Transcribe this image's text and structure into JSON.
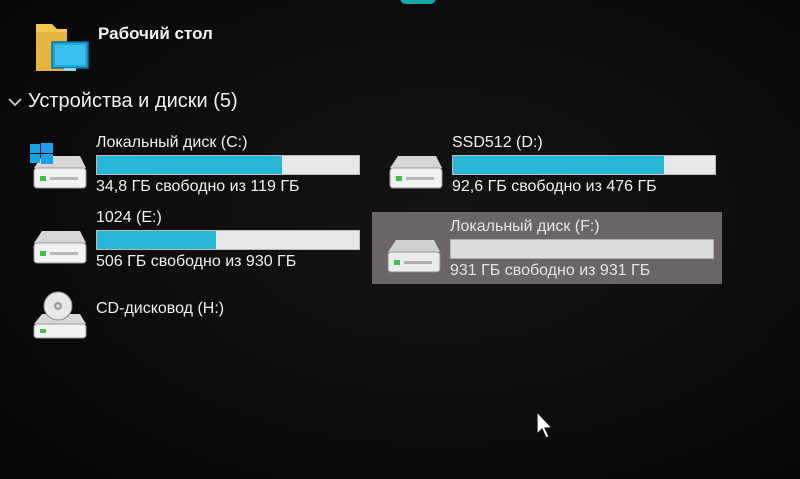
{
  "desktop": {
    "label": "Рабочий стол"
  },
  "group": {
    "title": "Устройства и диски (5)"
  },
  "drives": [
    {
      "name": "Локальный диск (C:)",
      "free_text": "34,8 ГБ свободно из 119 ГБ",
      "used_fraction": 0.708,
      "has_windows_logo": true,
      "selected": false
    },
    {
      "name": "SSD512 (D:)",
      "free_text": "92,6 ГБ свободно из 476 ГБ",
      "used_fraction": 0.806,
      "selected": false
    },
    {
      "name": "1024 (E:)",
      "free_text": "506 ГБ свободно из 930 ГБ",
      "used_fraction": 0.456,
      "selected": false
    },
    {
      "name": "Локальный диск (F:)",
      "free_text": "931 ГБ свободно из 931 ГБ",
      "used_fraction": 0.0,
      "selected": true
    },
    {
      "name": "CD-дисковод (H:)",
      "type": "optical",
      "selected": false
    }
  ],
  "colors": {
    "bar_fill": "#25b6d8",
    "bar_track": "#e8e8e8",
    "selection": "#6b6565",
    "background": "#0b0b0c"
  },
  "icons": {
    "desktop": "desktop-folder-icon",
    "drive": "hard-drive-icon",
    "optical": "cd-drive-icon",
    "cursor": "mouse-pointer-icon"
  }
}
